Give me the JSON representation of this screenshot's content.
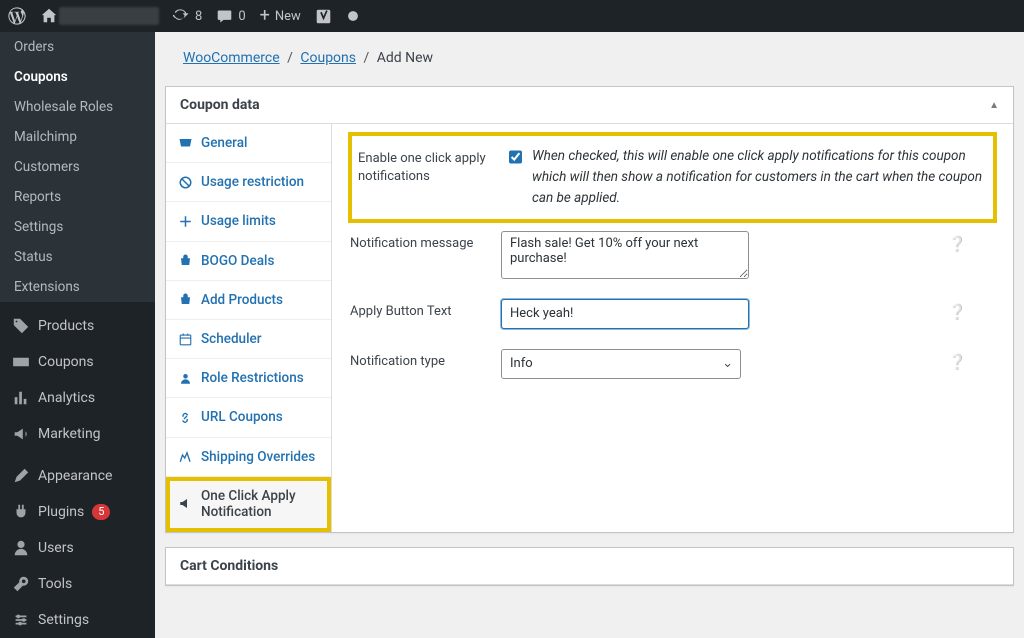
{
  "topbar": {
    "refresh_count": "8",
    "comment_count": "0",
    "new_label": "New"
  },
  "breadcrumb": {
    "woocommerce": "WooCommerce",
    "coupons": "Coupons",
    "addnew": "Add New"
  },
  "adminmenu": {
    "orders": "Orders",
    "coupons": "Coupons",
    "wholesale": "Wholesale Roles",
    "mailchimp": "Mailchimp",
    "customers": "Customers",
    "reports": "Reports",
    "settings": "Settings",
    "status": "Status",
    "extensions": "Extensions",
    "products": "Products",
    "coupons_main": "Coupons",
    "analytics": "Analytics",
    "marketing": "Marketing",
    "appearance": "Appearance",
    "plugins": "Plugins",
    "plugins_badge": "5",
    "users": "Users",
    "tools": "Tools",
    "settings_main": "Settings"
  },
  "panel": {
    "coupon_data": "Coupon data",
    "cart_conditions": "Cart Conditions"
  },
  "tabs": {
    "general": "General",
    "usage_restriction": "Usage restriction",
    "usage_limits": "Usage limits",
    "bogo": "BOGO Deals",
    "add_products": "Add Products",
    "scheduler": "Scheduler",
    "role_restrictions": "Role Restrictions",
    "url_coupons": "URL Coupons",
    "shipping": "Shipping Overrides",
    "one_click": "One Click Apply Notification"
  },
  "form": {
    "enable_label": "Enable one click apply notifications",
    "enable_desc": "When checked, this will enable one click apply notifications for this coupon which will then show a notification for customers in the cart when the coupon can be applied.",
    "message_label": "Notification message",
    "message_value": "Flash sale! Get 10% off your next purchase!",
    "button_label": "Apply Button Text",
    "button_value": "Heck yeah!",
    "type_label": "Notification type",
    "type_value": "Info"
  }
}
